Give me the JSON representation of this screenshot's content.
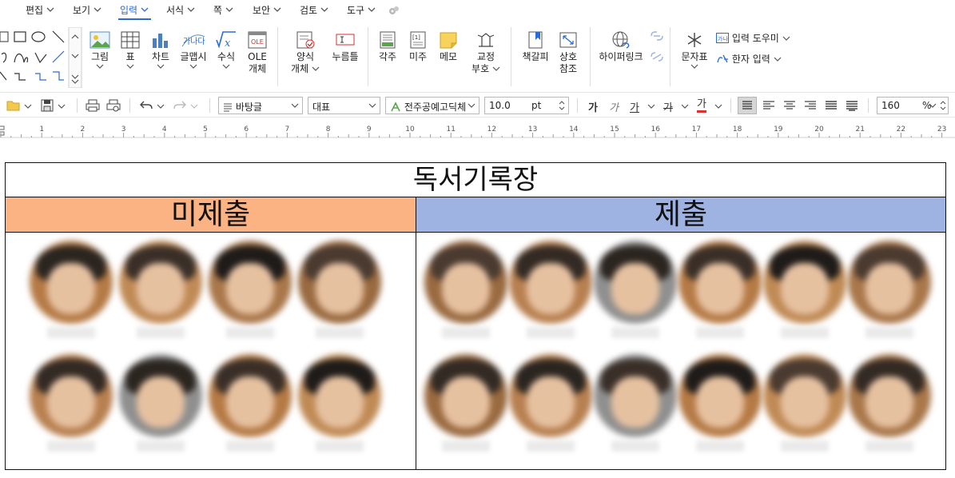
{
  "menu": {
    "items": [
      {
        "label": "편집",
        "active": false
      },
      {
        "label": "보기",
        "active": false
      },
      {
        "label": "입력",
        "active": true
      },
      {
        "label": "서식",
        "active": false
      },
      {
        "label": "쪽",
        "active": false
      },
      {
        "label": "보안",
        "active": false
      },
      {
        "label": "검토",
        "active": false
      },
      {
        "label": "도구",
        "active": false
      }
    ]
  },
  "ribbon": {
    "picture": "그림",
    "table": "표",
    "chart": "차트",
    "wordart": "글맵시",
    "formula": "수식",
    "ole_line1": "OLE",
    "ole_line2": "개체",
    "form_line1": "양식",
    "form_line2": "개체",
    "pushbutton": "누름틀",
    "footnote": "각주",
    "endnote": "미주",
    "memo": "메모",
    "proof_line1": "교정",
    "proof_line2": "부호",
    "bookmark": "책갈피",
    "crossref_line1": "상호",
    "crossref_line2": "참조",
    "hyperlink": "하이퍼링크",
    "charmap": "문자표",
    "input_helper": "입력 도우미",
    "hanja_input": "한자 입력",
    "ole_icon_text": "OLE",
    "footnote_icon_text": "[1]",
    "input_helper_icon_text": "가나",
    "wordart_icon_text": "가나다"
  },
  "toolbar": {
    "style": "바탕글",
    "para_style": "대표",
    "font": "전주공예고딕체",
    "font_size": "10.0",
    "font_unit": "pt",
    "bold": "가",
    "italic": "가",
    "underline": "가",
    "strike": "가",
    "color": "가",
    "zoom": "160",
    "zoom_unit": "%"
  },
  "ruler": {
    "numbers": [
      "1",
      "2",
      "3",
      "4",
      "5",
      "6",
      "7",
      "8",
      "9",
      "10",
      "11",
      "12",
      "13",
      "14",
      "15",
      "16",
      "17",
      "18",
      "19",
      "20",
      "21",
      "22",
      "23"
    ]
  },
  "document": {
    "title": "독서기록장",
    "left_header": "미제출",
    "right_header": "제출",
    "left_header_color": "#fbb383",
    "right_header_color": "#9fb3e2",
    "left_count": 8,
    "right_count": 12
  },
  "colors": {
    "accent": "#2b6bd6"
  }
}
